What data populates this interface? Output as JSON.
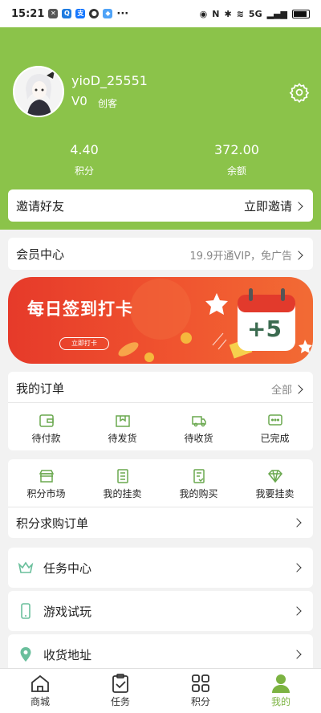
{
  "status": {
    "time": "15:21",
    "network": "5G"
  },
  "profile": {
    "username": "yioD_25551",
    "level": "V0",
    "role": "创客"
  },
  "stats": [
    {
      "value": "4.40",
      "label": "积分"
    },
    {
      "value": "372.00",
      "label": "余额"
    }
  ],
  "invite": {
    "title": "邀请好友",
    "action": "立即邀请"
  },
  "vip": {
    "title": "会员中心",
    "promo": "19.9开通VIP，免广告"
  },
  "banner": {
    "title": "每日签到打卡",
    "button": "立即打卡",
    "plus": "+5"
  },
  "orders": {
    "title": "我的订单",
    "all": "全部",
    "items": [
      "待付款",
      "待发货",
      "待收货",
      "已完成"
    ]
  },
  "market": {
    "items": [
      "积分市场",
      "我的挂卖",
      "我的购买",
      "我要挂卖"
    ],
    "purchase_orders": "积分求购订单"
  },
  "list": [
    {
      "label": "任务中心",
      "icon": "crown-icon"
    },
    {
      "label": "游戏试玩",
      "icon": "phone-icon"
    },
    {
      "label": "收货地址",
      "icon": "location-icon"
    }
  ],
  "tabs": [
    {
      "label": "商城",
      "icon": "home-icon"
    },
    {
      "label": "任务",
      "icon": "clipboard-check-icon"
    },
    {
      "label": "积分",
      "icon": "grid-icon"
    },
    {
      "label": "我的",
      "icon": "user-icon"
    }
  ],
  "colors": {
    "brand": "#8bc34a",
    "active_tab": "#7cb342",
    "banner": "#e63a2a"
  }
}
